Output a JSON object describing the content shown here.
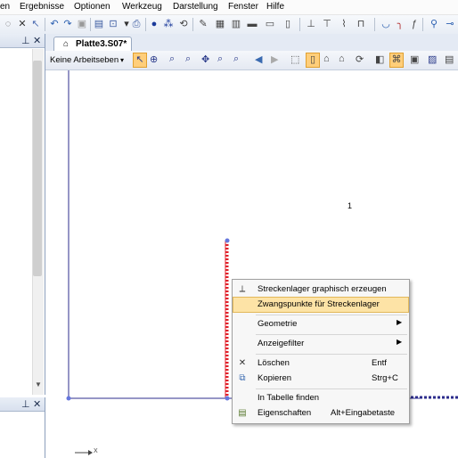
{
  "menubar": {
    "items": [
      "en",
      "Ergebnisse",
      "Optionen",
      "Werkzeug",
      "Darstellung",
      "Fenster",
      "Hilfe"
    ]
  },
  "document": {
    "tab_title": "Platte3.S07*",
    "workplane": "Keine Arbeitseben"
  },
  "canvas": {
    "node_label": "1",
    "axis_label": "X"
  },
  "context_menu": {
    "items": [
      {
        "label": "Streckenlager graphisch erzeugen",
        "shortcut": "",
        "icon": "line-support-icon"
      },
      {
        "label": "Zwangspunkte für Streckenlager",
        "shortcut": "",
        "icon": ""
      },
      {
        "label": "Geometrie",
        "shortcut": "",
        "icon": ""
      },
      {
        "label": "Anzeigefilter",
        "shortcut": "",
        "icon": ""
      },
      {
        "label": "Löschen",
        "shortcut": "Entf",
        "icon": "delete-icon"
      },
      {
        "label": "Kopieren",
        "shortcut": "Strg+C",
        "icon": "copy-icon"
      },
      {
        "label": "In Tabelle finden",
        "shortcut": "",
        "icon": ""
      },
      {
        "label": "Eigenschaften",
        "shortcut": "Alt+Eingabetaste",
        "icon": "properties-icon"
      }
    ]
  },
  "colors": {
    "support_line": "#e0202a",
    "highlight": "#fde3a6",
    "frame": "#2c2c8c"
  }
}
